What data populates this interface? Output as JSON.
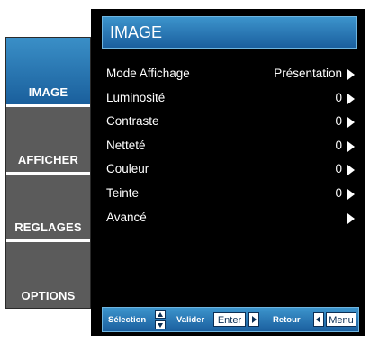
{
  "header": {
    "title": "IMAGE"
  },
  "tabs": [
    {
      "label": "IMAGE",
      "active": true
    },
    {
      "label": "AFFICHER",
      "active": false
    },
    {
      "label": "REGLAGES",
      "active": false
    },
    {
      "label": "OPTIONS",
      "active": false
    }
  ],
  "menu": {
    "items": [
      {
        "label": "Mode Affichage",
        "value": "Présentation"
      },
      {
        "label": "Luminosité",
        "value": "0"
      },
      {
        "label": "Contraste",
        "value": "0"
      },
      {
        "label": "Netteté",
        "value": "0"
      },
      {
        "label": "Couleur",
        "value": "0"
      },
      {
        "label": "Teinte",
        "value": "0"
      },
      {
        "label": "Avancé",
        "value": ""
      }
    ]
  },
  "footer": {
    "selection_label": "Sélection",
    "validate_label": "Valider",
    "enter_key": "Enter",
    "return_label": "Retour",
    "menu_key": "Menu"
  },
  "colors": {
    "accent_blue": "#1b5f9e",
    "panel_bg": "#000000",
    "tab_inactive": "#5b5b5b"
  }
}
